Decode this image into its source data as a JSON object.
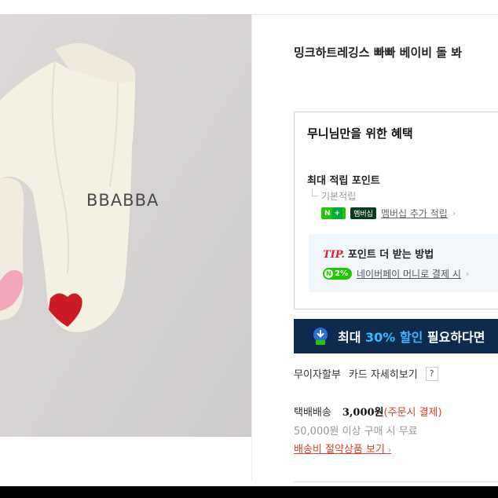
{
  "product": {
    "photo_watermark": "BBABBA",
    "title": "밍크하트레깅스 빠빠 베이비 돌 봐"
  },
  "benefits": {
    "title": "무니님만을 위한 혜택",
    "points_label": "최대 적립 포인트",
    "basic_points_label": "기본적립",
    "npay_badge": "N",
    "npay_plus": "+",
    "membership_badge": "멤버십",
    "membership_link": "멤버십 추가 적립",
    "tip": {
      "tag": "TIP.",
      "heading": "포인트 더 받는 방법",
      "badge_letter": "N",
      "badge_rate": "2%",
      "link": "네이버페이 머니로 결제 시"
    }
  },
  "promo": {
    "prefix": "최대",
    "accent": "30% 할인",
    "suffix": "필요하다면"
  },
  "installment": {
    "label": "무이자할부",
    "card_link": "카드 자세히보기",
    "help": "?"
  },
  "shipping": {
    "method": "택배배송",
    "fee": "3,000원",
    "fee_note": "(주문시 결제)",
    "free_condition": "50,000원 이상 구매 시 무료",
    "saver_link": "배송비 절약상품 보기"
  },
  "colors": {
    "naver_green": "#1ec800",
    "banner_navy": "#0e2a4d",
    "banner_accent": "#39b8ff",
    "tip_red": "#e0202b",
    "link_red": "#d9432d",
    "heart_pink": "#f1a9b8",
    "heart_red": "#cc1b22",
    "fabric": "#f4f0e2"
  },
  "icons": {
    "download_coupon": "download-icon",
    "chevron": "chevron-right-icon"
  }
}
